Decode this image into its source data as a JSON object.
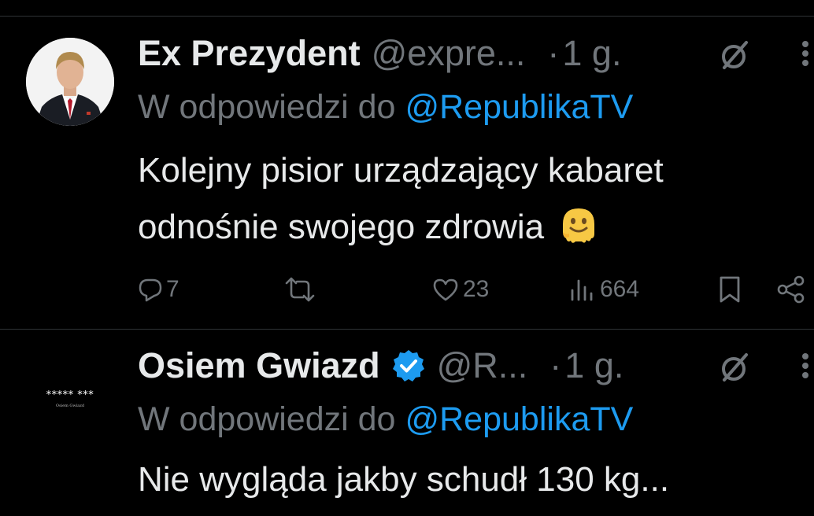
{
  "tweets": [
    {
      "display_name": "Ex Prezydent",
      "handle": "@expre...",
      "dot": "·",
      "time": "1 g.",
      "verified": false,
      "reply_prefix": "W odpowiedzi do",
      "reply_mention": "@RepublikaTV",
      "text": "Kolejny pisior urządzający kabaret odnośnie swojego zdrowia",
      "emoji": "melting-face-icon",
      "actions": {
        "replies": "7",
        "reposts": "",
        "likes": "23",
        "views": "664"
      }
    },
    {
      "display_name": "Osiem Gwiazd",
      "handle": "@R...",
      "dot": "·",
      "time": "1 g.",
      "verified": true,
      "reply_prefix": "W odpowiedzi do",
      "reply_mention": "@RepublikaTV",
      "text": "Nie wygląda jakby schudł 130 kg...",
      "avatar_text": "***** ***",
      "avatar_subtext": "Osiem Gwiazd"
    }
  ],
  "colors": {
    "background": "#000000",
    "primary_text": "#e7e9ea",
    "secondary_text": "#71767b",
    "link": "#1d9bf0",
    "divider": "#2f3336"
  }
}
